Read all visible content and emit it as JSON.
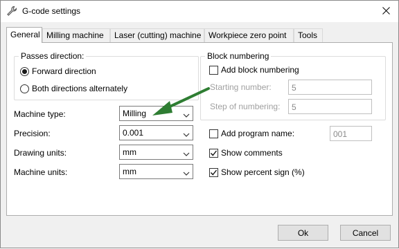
{
  "window": {
    "title": "G-code settings"
  },
  "tabs": [
    {
      "label": "General",
      "active": true
    },
    {
      "label": "Milling machine",
      "active": false
    },
    {
      "label": "Laser (cutting) machine",
      "active": false
    },
    {
      "label": "Workpiece zero point",
      "active": false
    },
    {
      "label": "Tools",
      "active": false
    }
  ],
  "passes": {
    "title": "Passes direction:",
    "options": [
      {
        "label": "Forward direction",
        "selected": true
      },
      {
        "label": "Both directions alternately",
        "selected": false
      }
    ]
  },
  "block_numbering": {
    "title": "Block numbering",
    "add_label": "Add block numbering",
    "add_checked": false,
    "starting_label": "Starting number:",
    "starting_value": "5",
    "step_label": "Step of numbering:",
    "step_value": "5"
  },
  "fields": {
    "machine_type": {
      "label": "Machine type:",
      "value": "Milling"
    },
    "precision": {
      "label": "Precision:",
      "value": "0.001"
    },
    "drawing_units": {
      "label": "Drawing units:",
      "value": "mm"
    },
    "machine_units": {
      "label": "Machine units:",
      "value": "mm"
    }
  },
  "program": {
    "add_name_label": "Add program name:",
    "add_name_checked": false,
    "name_value": "001",
    "show_comments_label": "Show comments",
    "show_comments_checked": true,
    "show_percent_label": "Show percent sign (%)",
    "show_percent_checked": true
  },
  "buttons": {
    "ok": "Ok",
    "cancel": "Cancel"
  },
  "colors": {
    "arrow": "#2e7d32"
  }
}
